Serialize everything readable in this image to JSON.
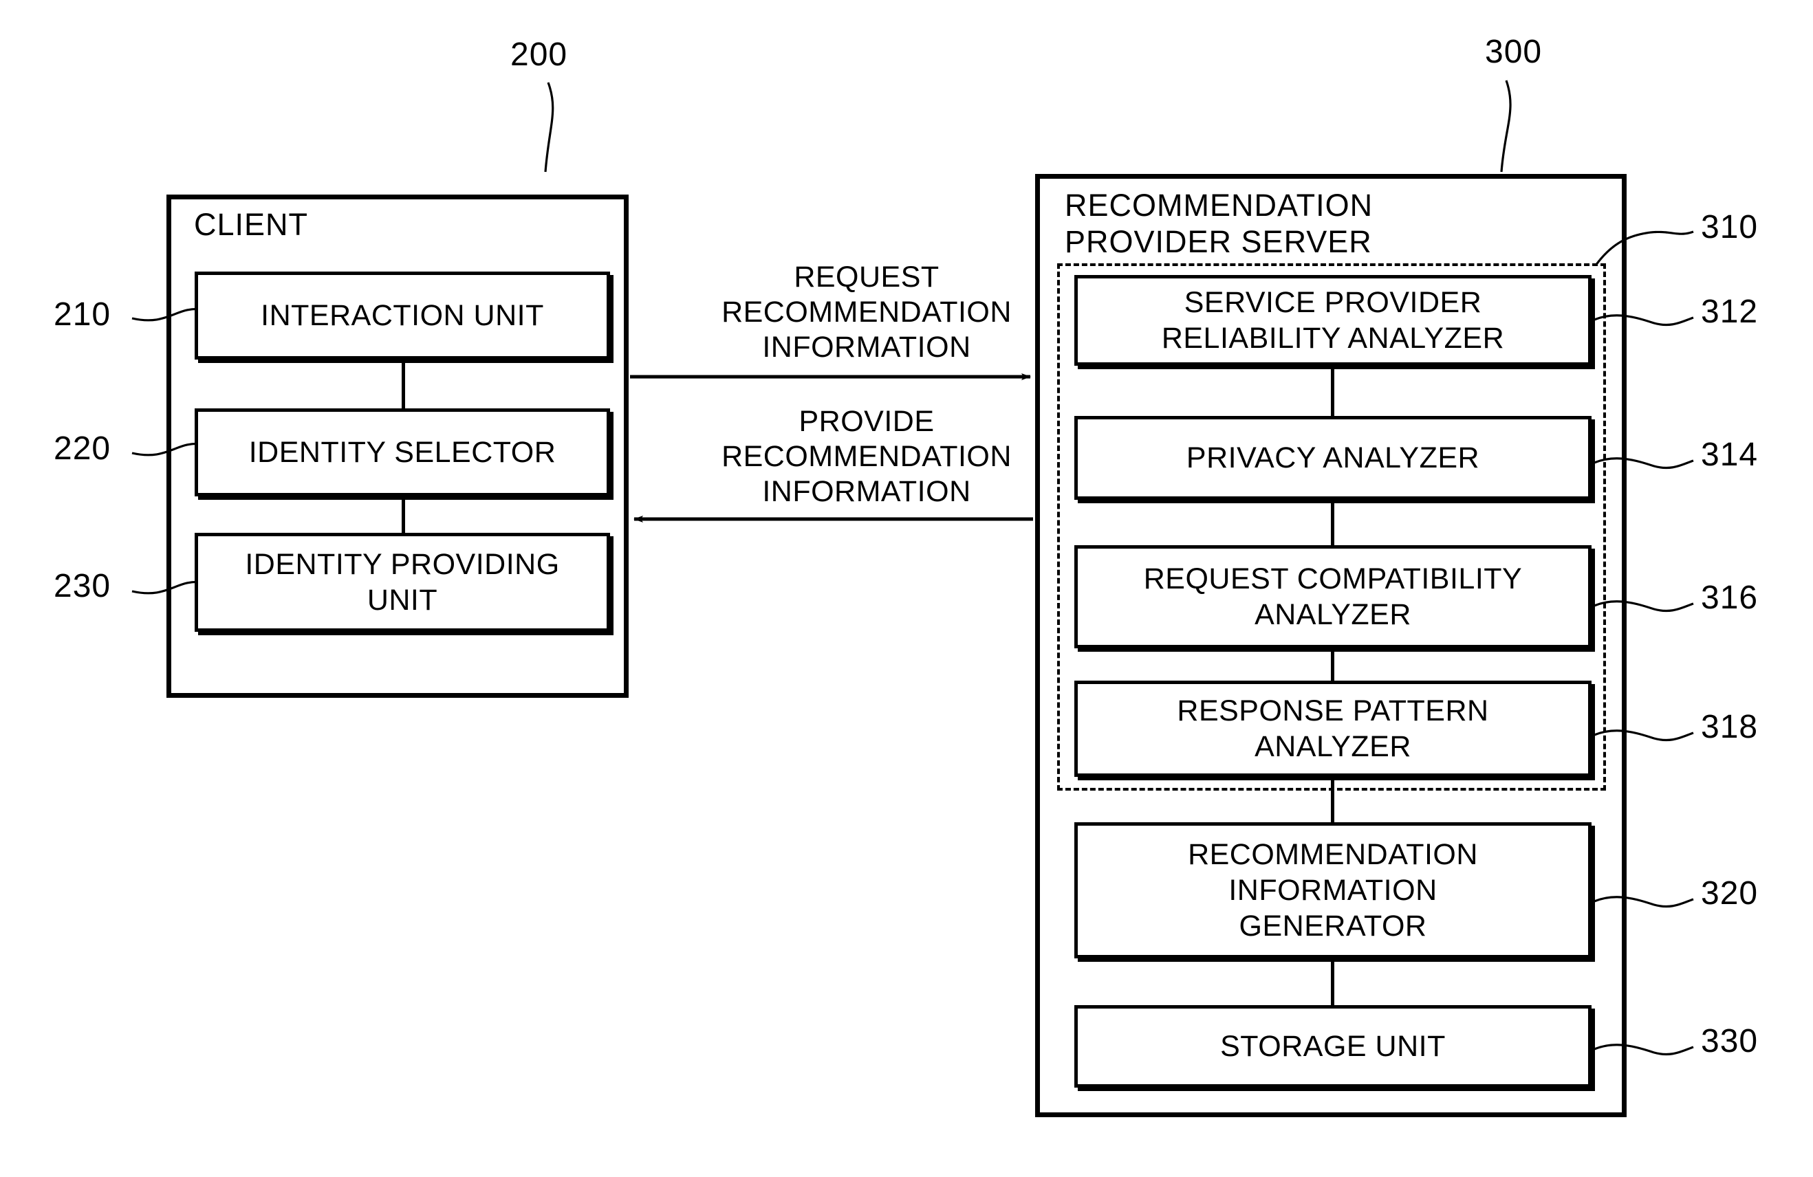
{
  "figure": {
    "type": "patent-block-diagram",
    "background_color": "#ffffff",
    "line_color": "#000000"
  },
  "client": {
    "ref": "200",
    "title": "CLIENT",
    "units": [
      {
        "ref": "210",
        "label": "INTERACTION UNIT"
      },
      {
        "ref": "220",
        "label": "IDENTITY SELECTOR"
      },
      {
        "ref": "230",
        "label": "IDENTITY PROVIDING\nUNIT"
      }
    ]
  },
  "server": {
    "ref": "300",
    "title": "RECOMMENDATION\nPROVIDER SERVER",
    "analyzer_group": {
      "ref": "310",
      "style": "dashed",
      "units": [
        {
          "ref": "312",
          "label": "SERVICE PROVIDER\nRELIABILITY ANALYZER"
        },
        {
          "ref": "314",
          "label": "PRIVACY ANALYZER"
        },
        {
          "ref": "316",
          "label": "REQUEST COMPATIBILITY\nANALYZER"
        },
        {
          "ref": "318",
          "label": "RESPONSE PATTERN\nANALYZER"
        }
      ]
    },
    "units": [
      {
        "ref": "320",
        "label": "RECOMMENDATION\nINFORMATION\nGENERATOR"
      },
      {
        "ref": "330",
        "label": "STORAGE UNIT"
      }
    ]
  },
  "flows": [
    {
      "id": "request",
      "label": "REQUEST\nRECOMMENDATION\nINFORMATION",
      "direction": "client-to-server"
    },
    {
      "id": "provide",
      "label": "PROVIDE\nRECOMMENDATION\nINFORMATION",
      "direction": "server-to-client"
    }
  ]
}
